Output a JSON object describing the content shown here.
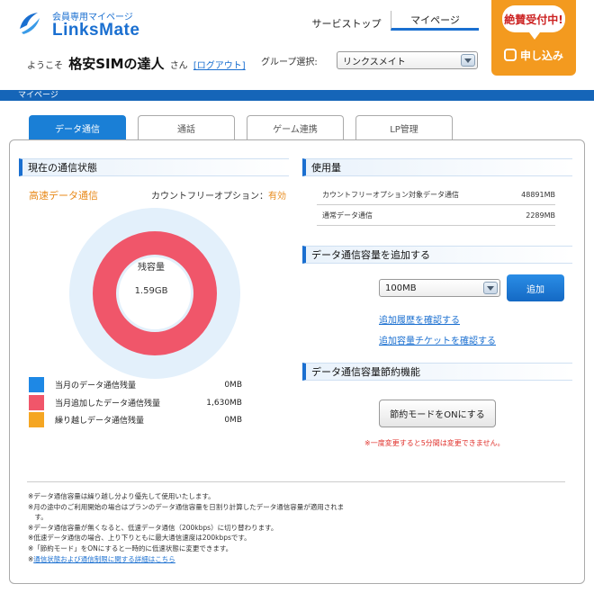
{
  "header": {
    "logo_sub": "会員専用マイページ",
    "logo_main": "LinksMate",
    "welcome_prefix": "ようこそ",
    "user_name": "格安SIMの達人",
    "welcome_suffix": "さん",
    "logout_label": "[ログアウト]",
    "nav": [
      {
        "label": "サービストップ"
      },
      {
        "label": "マイページ"
      }
    ],
    "group_label": "グループ選択:",
    "group_value": "リンクスメイト",
    "promo_bubble": "絶賛受付中!",
    "promo_button": "申し込み"
  },
  "breadcrumb": "マイページ",
  "tabs": [
    {
      "label": "データ通信"
    },
    {
      "label": "通話"
    },
    {
      "label": "ゲーム連携"
    },
    {
      "label": "LP管理"
    }
  ],
  "status": {
    "heading": "現在の通信状態",
    "speed": "高速データ通信",
    "option_label": "カウントフリーオプション：",
    "option_value": "有効",
    "remain_label": "残容量",
    "remain_value": "1.59GB",
    "legend": [
      {
        "name": "当月のデータ通信残量",
        "value": "0MB",
        "color": "#1e88e5",
        "mb": 0
      },
      {
        "name": "当月追加したデータ通信残量",
        "value": "1,630MB",
        "color": "#f0566a",
        "mb": 1630
      },
      {
        "name": "繰り越しデータ通信残量",
        "value": "0MB",
        "color": "#f5a623",
        "mb": 0
      }
    ],
    "ring_track_color": "#e3f0fb"
  },
  "usage": {
    "heading": "使用量",
    "rows": [
      {
        "label": "カウントフリーオプション対象データ通信",
        "value": "48891MB"
      },
      {
        "label": "通常データ通信",
        "value": "2289MB"
      }
    ]
  },
  "add": {
    "heading": "データ通信容量を追加する",
    "select_value": "100MB",
    "button": "追加",
    "history_link": "追加履歴を確認する",
    "ticket_link": "追加容量チケットを確認する"
  },
  "saving": {
    "heading": "データ通信容量節約機能",
    "button": "節約モードをONにする",
    "warning": "※一度変更すると5分間は変更できません。"
  },
  "notes": [
    "※データ通信容量は繰り越し分より優先して使用いたします。",
    "※月の途中のご利用開始の場合はプランのデータ通信容量を日割り計算したデータ通信容量が適用されま",
    "　す。",
    "※データ通信容量が無くなると、低速データ通信（200kbps）に切り替わります。",
    "※低速データ通信の場合、上り下りともに最大通信速度は200kbpsです。",
    "※「節約モード」をONにすると一時的に低速状態に変更できます。"
  ],
  "notes_link": "通信状態および通信制限に関する詳細はこちら"
}
